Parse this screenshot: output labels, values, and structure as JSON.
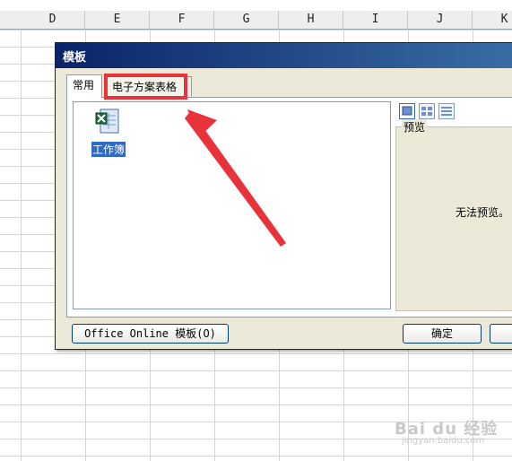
{
  "sheet": {
    "columns": [
      "D",
      "E",
      "F",
      "G",
      "H",
      "I",
      "J",
      "K"
    ]
  },
  "dialog": {
    "title": "模板",
    "tabs": [
      {
        "label": "常用"
      },
      {
        "label": "电子方案表格"
      }
    ],
    "templates": [
      {
        "label": "工作簿",
        "icon": "excel-workbook-icon"
      }
    ],
    "preview": {
      "label": "预览",
      "message": "无法预览。"
    },
    "buttons": {
      "office_online": "Office Online 模板(O)",
      "ok": "确定"
    }
  },
  "annotation": {
    "highlight_color": "#e8333a"
  },
  "watermark": {
    "brand": "Bai du 经验",
    "url": "jingyan.baidu.com"
  }
}
